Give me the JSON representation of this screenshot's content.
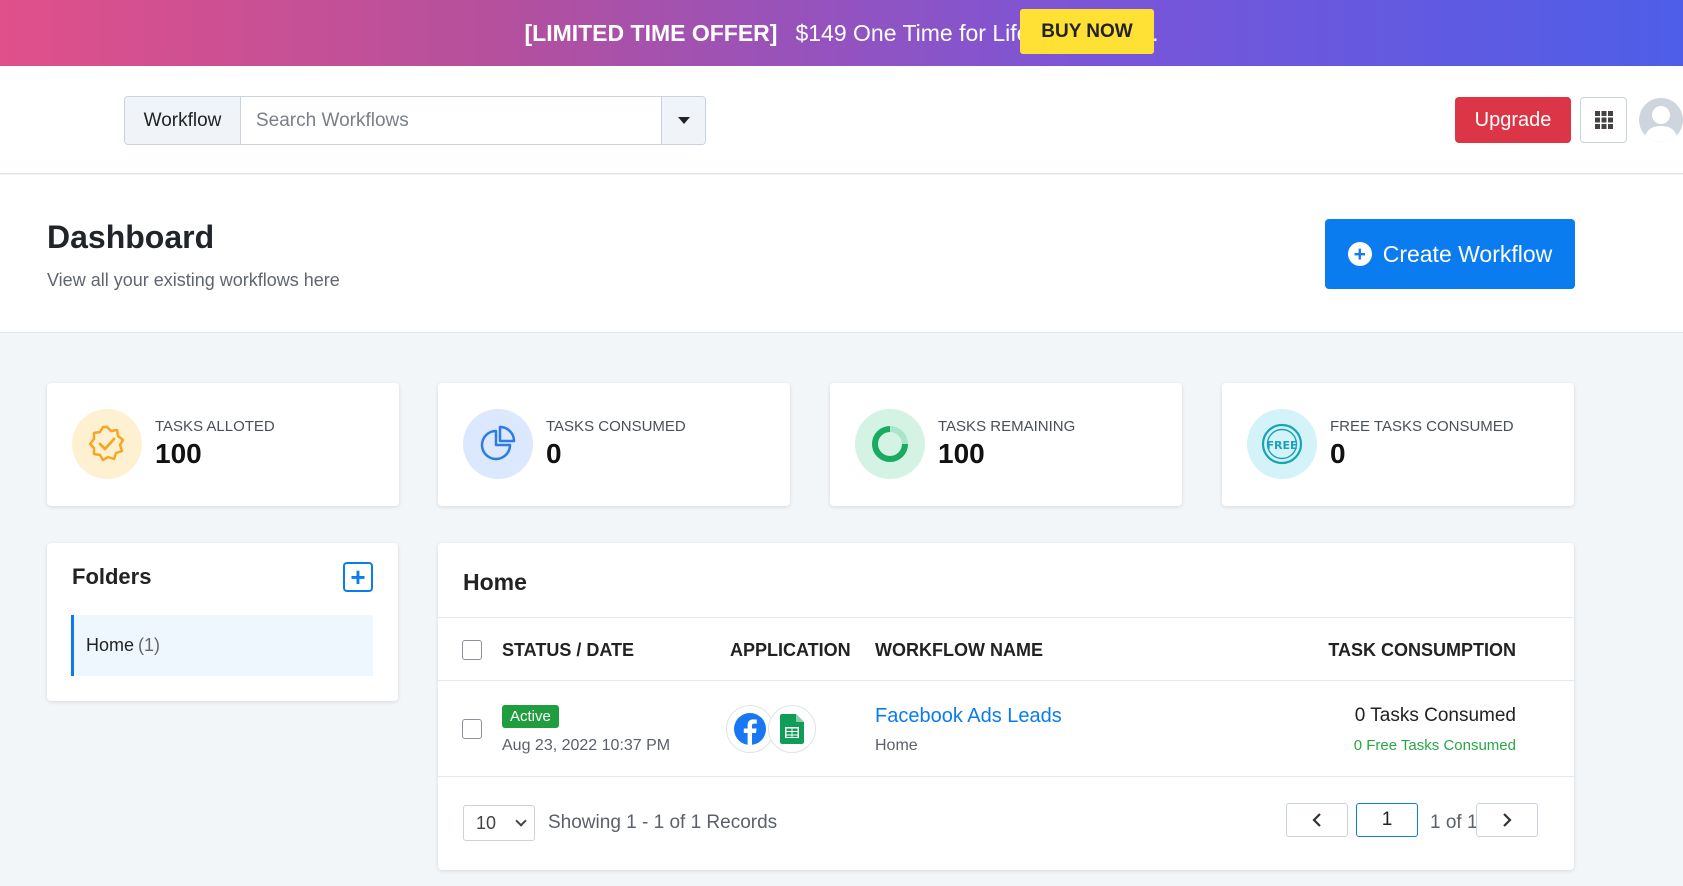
{
  "promo": {
    "offer": "[LIMITED TIME OFFER]",
    "text": "$149 One Time for Lifetime Access.",
    "buy_label": "BUY NOW"
  },
  "header": {
    "search_prefix": "Workflow",
    "search_placeholder": "Search Workflows",
    "upgrade_label": "Upgrade"
  },
  "page": {
    "title": "Dashboard",
    "subtitle": "View all your existing workflows here",
    "create_label": "Create Workflow"
  },
  "stats": [
    {
      "label": "TASKS ALLOTED",
      "value": "100",
      "icon": "badge-check-icon",
      "bg": "#fdf1d2",
      "color": "#f5a623"
    },
    {
      "label": "TASKS CONSUMED",
      "value": "0",
      "icon": "pie-chart-icon",
      "bg": "#dbe8fd",
      "color": "#2d7be5"
    },
    {
      "label": "TASKS REMAINING",
      "value": "100",
      "icon": "progress-ring-icon",
      "bg": "#d5f3e4",
      "color": "#1aaa62"
    },
    {
      "label": "FREE TASKS CONSUMED",
      "value": "0",
      "icon": "free-stamp-icon",
      "bg": "#d3f3f8",
      "color": "#1aa3b8"
    }
  ],
  "folders": {
    "title": "Folders",
    "items": [
      {
        "label": "Home",
        "count": "(1)"
      }
    ]
  },
  "workflows": {
    "title": "Home",
    "columns": {
      "status": "STATUS / DATE",
      "application": "APPLICATION",
      "name": "WORKFLOW NAME",
      "consumption": "TASK CONSUMPTION"
    },
    "rows": [
      {
        "status": "Active",
        "date": "Aug 23, 2022 10:37 PM",
        "apps": [
          "facebook-icon",
          "google-sheets-icon"
        ],
        "name": "Facebook Ads Leads",
        "folder": "Home",
        "tasks": "0 Tasks Consumed",
        "free_tasks": "0 Free Tasks Consumed"
      }
    ],
    "pager": {
      "per_page": "10",
      "showing": "Showing 1 - 1 of 1 Records",
      "page": "1",
      "of": "1 of 1"
    }
  }
}
